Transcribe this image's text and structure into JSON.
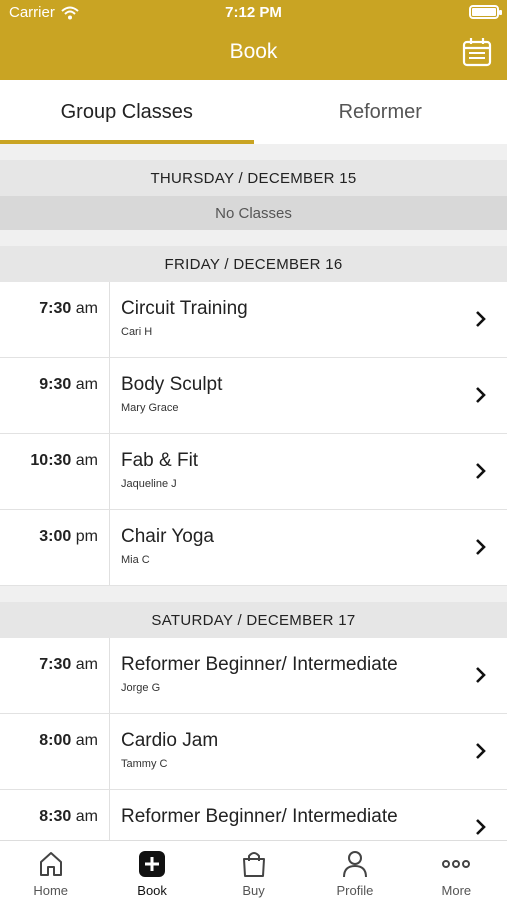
{
  "status_bar": {
    "carrier": "Carrier",
    "time": "7:12 PM"
  },
  "nav": {
    "title": "Book",
    "calendar_icon": "calendar-icon"
  },
  "tabs": [
    {
      "label": "Group Classes",
      "active": true
    },
    {
      "label": "Reformer",
      "active": false
    }
  ],
  "days": [
    {
      "header": "THURSDAY / DECEMBER 15",
      "empty_text": "No Classes",
      "classes": []
    },
    {
      "header": "FRIDAY / DECEMBER 16",
      "classes": [
        {
          "time": "7:30",
          "ampm": "am",
          "name": "Circuit Training",
          "instructor": "Cari H"
        },
        {
          "time": "9:30",
          "ampm": "am",
          "name": "Body Sculpt",
          "instructor": "Mary Grace"
        },
        {
          "time": "10:30",
          "ampm": "am",
          "name": "Fab & Fit",
          "instructor": "Jaqueline J"
        },
        {
          "time": "3:00",
          "ampm": "pm",
          "name": "Chair Yoga",
          "instructor": "Mia C"
        }
      ]
    },
    {
      "header": "SATURDAY / DECEMBER 17",
      "classes": [
        {
          "time": "7:30",
          "ampm": "am",
          "name": "Reformer Beginner/ Intermediate",
          "instructor": "Jorge G"
        },
        {
          "time": "8:00",
          "ampm": "am",
          "name": "Cardio Jam",
          "instructor": "Tammy C"
        },
        {
          "time": "8:30",
          "ampm": "am",
          "name": "Reformer Beginner/ Intermediate",
          "instructor": ""
        }
      ]
    }
  ],
  "tabbar": [
    {
      "label": "Home",
      "icon": "home-icon",
      "active": false
    },
    {
      "label": "Book",
      "icon": "plus-square-icon",
      "active": true
    },
    {
      "label": "Buy",
      "icon": "shopping-bag-icon",
      "active": false
    },
    {
      "label": "Profile",
      "icon": "person-icon",
      "active": false
    },
    {
      "label": "More",
      "icon": "more-dots-icon",
      "active": false
    }
  ],
  "colors": {
    "accent": "#c9a423",
    "header_bg": "#c9a423",
    "day_header_bg": "#e6e6e6"
  }
}
